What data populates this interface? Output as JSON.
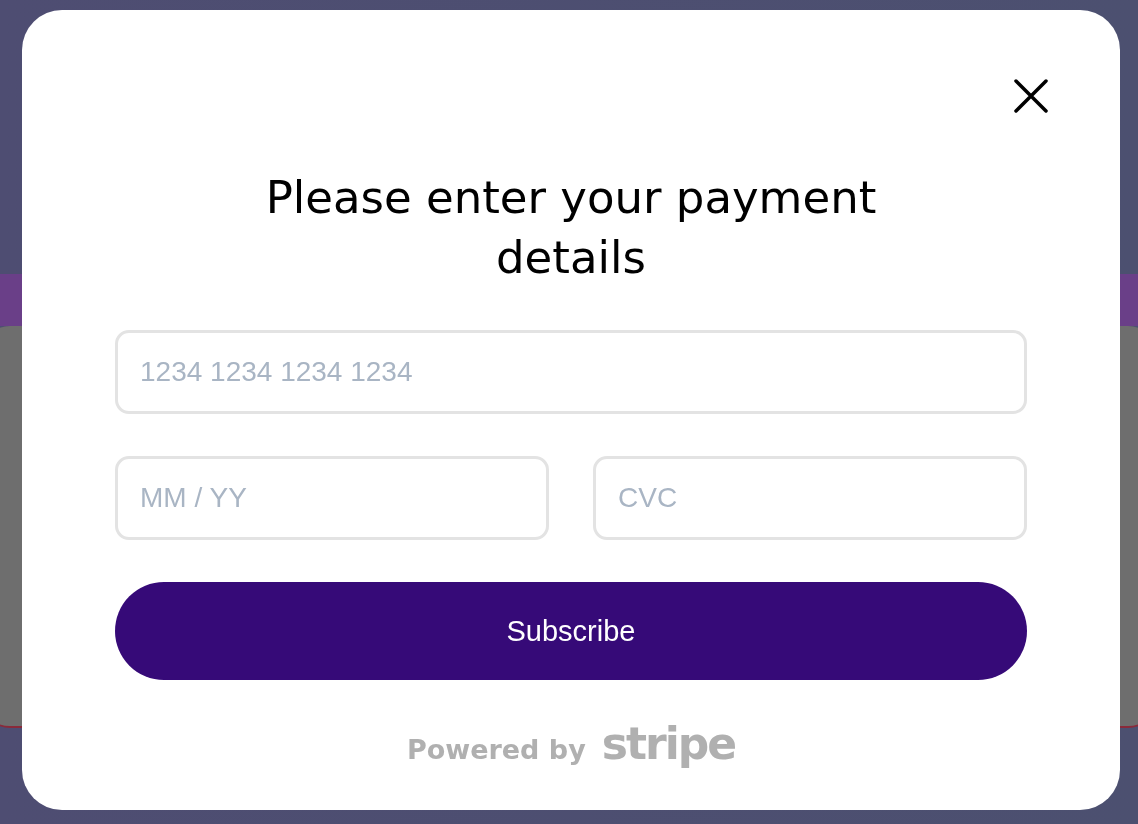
{
  "dialog": {
    "title": "Please enter your payment details",
    "fields": [
      {
        "placeholder": "1234 1234 1234 1234"
      },
      {
        "placeholder": "MM / YY"
      },
      {
        "placeholder": "CVC"
      }
    ],
    "submit_button": "Subscribe",
    "footer": {
      "text": "Powered by",
      "brand": "stripe"
    }
  }
}
